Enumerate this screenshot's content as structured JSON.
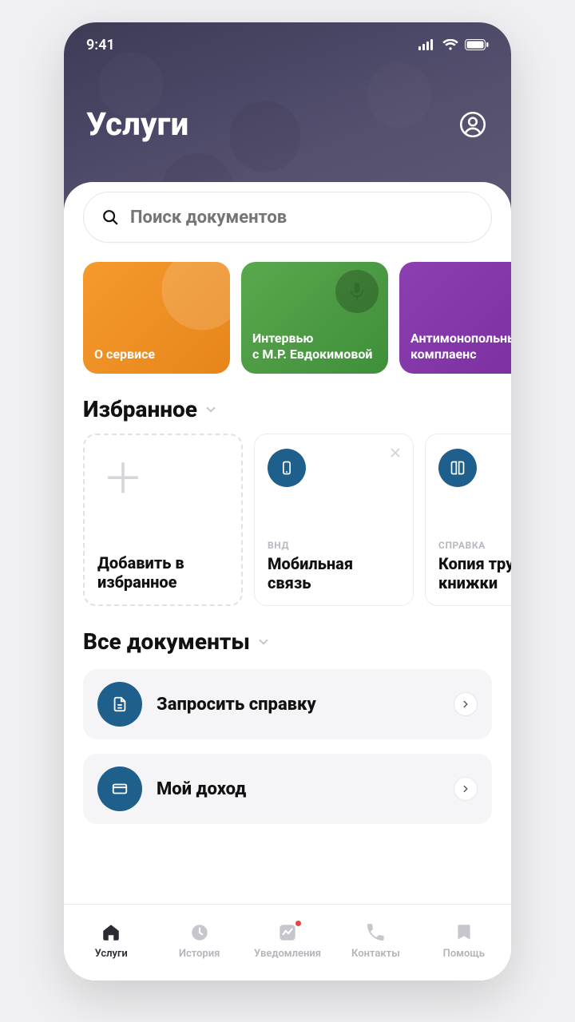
{
  "status": {
    "time": "9:41"
  },
  "header": {
    "title": "Услуги"
  },
  "search": {
    "placeholder": "Поиск документов"
  },
  "featured": [
    {
      "title": "О сервисе"
    },
    {
      "title": "Интервью\nс М.Р. Евдокимовой"
    },
    {
      "title": "Антимонопольный\nкомплаенс"
    }
  ],
  "sections": {
    "favorites_title": "Избранное",
    "all_docs_title": "Все документы"
  },
  "favorites": {
    "add_label": "Добавить\nв избранное",
    "items": [
      {
        "category": "ВНД",
        "title": "Мобильная связь"
      },
      {
        "category": "СПРАВКА",
        "title": "Копия трудовой книжки"
      }
    ]
  },
  "documents": [
    {
      "title": "Запросить справку"
    },
    {
      "title": "Мой доход"
    }
  ],
  "tabs": [
    {
      "label": "Услуги"
    },
    {
      "label": "История"
    },
    {
      "label": "Уведомления"
    },
    {
      "label": "Контакты"
    },
    {
      "label": "Помощь"
    }
  ]
}
